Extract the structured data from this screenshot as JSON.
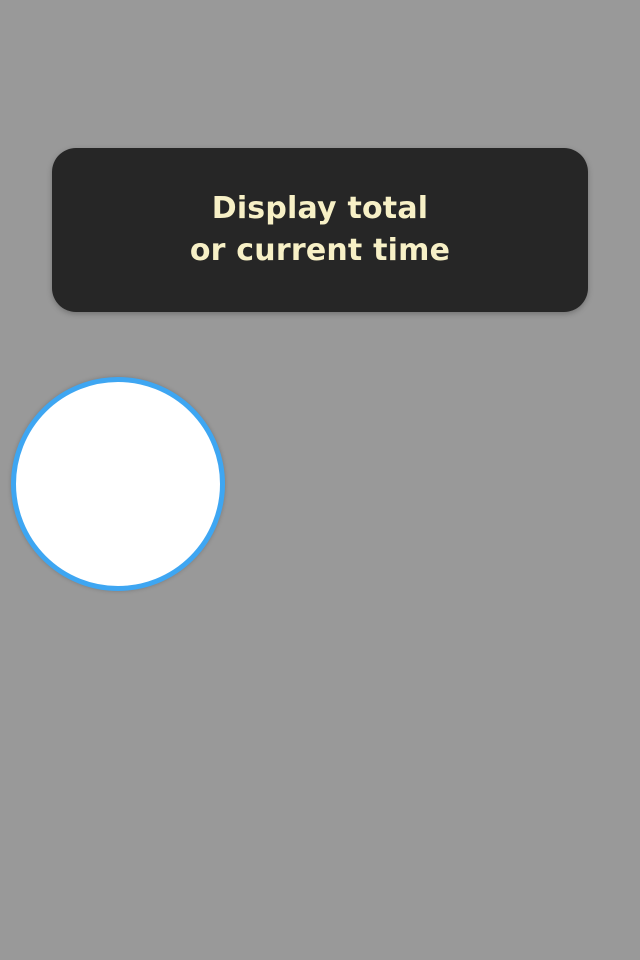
{
  "tutorial": {
    "tooltip_text": "Display total\nor current time"
  },
  "colors": {
    "overlay": "#999999",
    "tooltip_background": "#262626",
    "tooltip_text": "#f7f0c6",
    "spotlight_fill": "#ffffff",
    "spotlight_ring": "#3ea6f2"
  }
}
